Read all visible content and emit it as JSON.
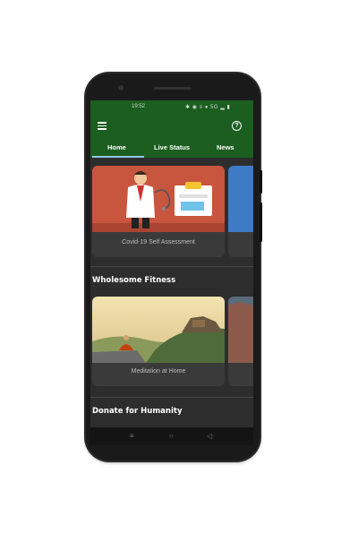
{
  "status_bar": {
    "time": "19:52",
    "icons": "✱ ◉ ≡ ● 5G ▂ ▮"
  },
  "app_bar": {
    "menu_icon": "hamburger-menu-icon",
    "help_icon": "help-circle-icon",
    "help_glyph": "?"
  },
  "tabs": [
    {
      "label": "Home",
      "selected": true
    },
    {
      "label": "Live Status",
      "selected": false
    },
    {
      "label": "News",
      "selected": false
    }
  ],
  "cards_row_1": [
    {
      "caption": "Covid-19 Self Assessment"
    }
  ],
  "sections": {
    "fitness_title": "Wholesome Fitness",
    "donate_title": "Donate for Humanity"
  },
  "cards_row_2": [
    {
      "caption": "Meditation at Home"
    }
  ],
  "nav_bar": {
    "menu_glyph": "≡",
    "home_glyph": "○",
    "back_glyph": "◁"
  },
  "colors": {
    "primary": "#1b5e20",
    "background": "#2d2d2d",
    "card": "#3a3a3a",
    "tab_indicator": "#90caf9"
  }
}
